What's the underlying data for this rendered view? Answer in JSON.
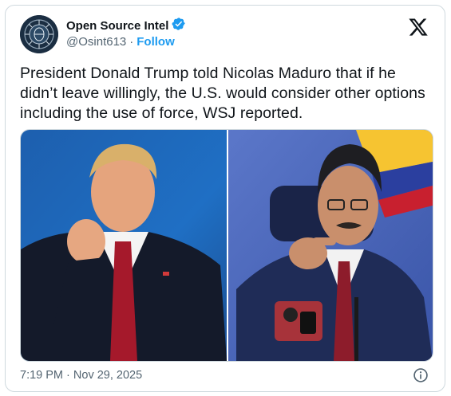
{
  "author": {
    "display_name": "Open Source Intel",
    "handle": "@Osint613",
    "separator": "·",
    "follow_label": "Follow"
  },
  "tweet": {
    "text": "President Donald Trump told Nicolas Maduro that if he didn’t leave willingly, the U.S. would consider other options including the use of force, WSJ reported."
  },
  "meta": {
    "time": "7:19 PM",
    "separator": "·",
    "date": "Nov 29, 2025"
  },
  "icons": {
    "verified": "verified-badge-icon",
    "platform": "x-logo-icon",
    "info": "info-icon"
  },
  "colors": {
    "accent": "#1d9bf0",
    "text": "#0f1419",
    "secondary": "#536471"
  }
}
